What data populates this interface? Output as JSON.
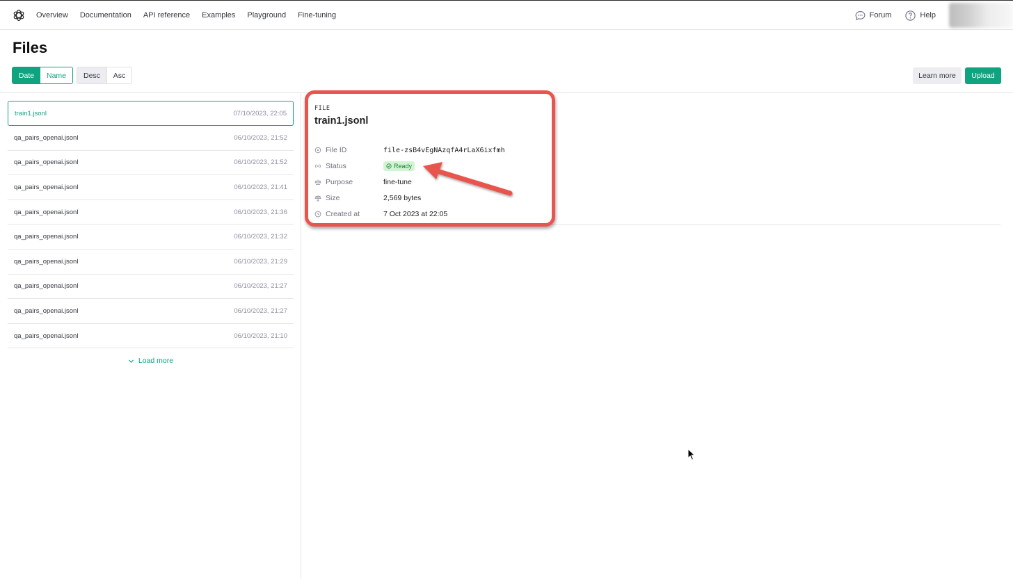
{
  "nav": {
    "links": [
      "Overview",
      "Documentation",
      "API reference",
      "Examples",
      "Playground",
      "Fine-tuning"
    ],
    "forum_label": "Forum",
    "help_label": "Help"
  },
  "page": {
    "title": "Files",
    "sort_by": {
      "date_label": "Date",
      "name_label": "Name",
      "selected": "Date"
    },
    "order": {
      "desc_label": "Desc",
      "asc_label": "Asc",
      "selected": "Desc"
    },
    "learn_more_label": "Learn more",
    "upload_label": "Upload"
  },
  "files": [
    {
      "name": "train1.jsonl",
      "date": "07/10/2023, 22:05",
      "selected": true
    },
    {
      "name": "qa_pairs_openai.jsonl",
      "date": "06/10/2023, 21:52"
    },
    {
      "name": "qa_pairs_openai.jsonl",
      "date": "06/10/2023, 21:52"
    },
    {
      "name": "qa_pairs_openai.jsonl",
      "date": "06/10/2023, 21:41"
    },
    {
      "name": "qa_pairs_openai.jsonl",
      "date": "06/10/2023, 21:36"
    },
    {
      "name": "qa_pairs_openai.jsonl",
      "date": "06/10/2023, 21:32"
    },
    {
      "name": "qa_pairs_openai.jsonl",
      "date": "06/10/2023, 21:29"
    },
    {
      "name": "qa_pairs_openai.jsonl",
      "date": "06/10/2023, 21:27"
    },
    {
      "name": "qa_pairs_openai.jsonl",
      "date": "06/10/2023, 21:27"
    },
    {
      "name": "qa_pairs_openai.jsonl",
      "date": "06/10/2023, 21:10"
    }
  ],
  "load_more_label": "Load more",
  "detail": {
    "kicker": "FILE",
    "title": "train1.jsonl",
    "file_id_label": "File ID",
    "file_id": "file-zsB4vEgNAzqfA4rLaX6ixfmh",
    "status_label": "Status",
    "status": "Ready",
    "purpose_label": "Purpose",
    "purpose": "fine-tune",
    "size_label": "Size",
    "size": "2,569 bytes",
    "created_label": "Created at",
    "created": "7 Oct 2023 at 22:05"
  },
  "colors": {
    "accent": "#10a37f",
    "annotation": "#e8554e",
    "status_bg": "#d2f4d3"
  },
  "icons": {
    "logo": "openai-logo-icon",
    "forum": "chat-bubble-icon",
    "help": "question-circle-icon",
    "load_more": "chevron-down-icon"
  }
}
